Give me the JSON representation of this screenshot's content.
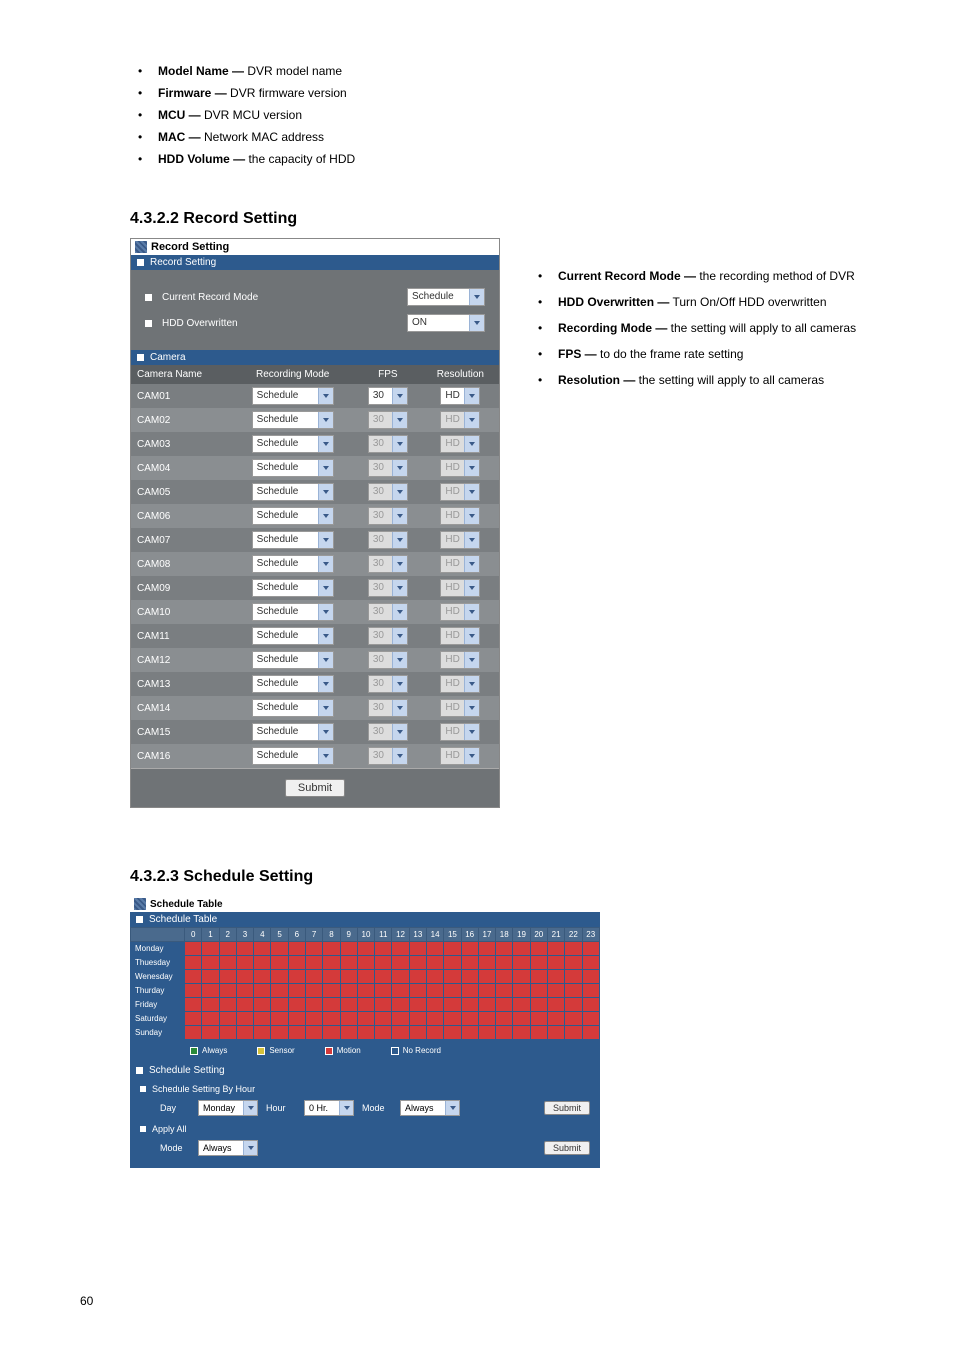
{
  "top_bullets": [
    {
      "term": "Model Name —",
      "desc": " DVR model name"
    },
    {
      "term": "Firmware —",
      "desc": " DVR firmware version"
    },
    {
      "term": "MCU —",
      "desc": " DVR MCU version"
    },
    {
      "term": "MAC —",
      "desc": " Network MAC address"
    },
    {
      "term": "HDD Volume —",
      "desc": " the capacity of HDD"
    }
  ],
  "section_heading": "4.3.2.2 Record Setting",
  "record_panel": {
    "title": "Record Setting",
    "sub1": "Record Setting",
    "row1_label": "Current Record Mode",
    "row1_value": "Schedule",
    "row2_label": "HDD Overwritten",
    "row2_value": "ON",
    "sub2": "Camera",
    "headers": [
      "Camera Name",
      "Recording Mode",
      "FPS",
      "Resolution"
    ],
    "cameras": [
      {
        "name": "CAM01",
        "mode": "Schedule",
        "fps": "30",
        "res": "HD",
        "fps_dis": false,
        "res_dis": false
      },
      {
        "name": "CAM02",
        "mode": "Schedule",
        "fps": "30",
        "res": "HD",
        "fps_dis": true,
        "res_dis": true
      },
      {
        "name": "CAM03",
        "mode": "Schedule",
        "fps": "30",
        "res": "HD",
        "fps_dis": true,
        "res_dis": true
      },
      {
        "name": "CAM04",
        "mode": "Schedule",
        "fps": "30",
        "res": "HD",
        "fps_dis": true,
        "res_dis": true
      },
      {
        "name": "CAM05",
        "mode": "Schedule",
        "fps": "30",
        "res": "HD",
        "fps_dis": true,
        "res_dis": true
      },
      {
        "name": "CAM06",
        "mode": "Schedule",
        "fps": "30",
        "res": "HD",
        "fps_dis": true,
        "res_dis": true
      },
      {
        "name": "CAM07",
        "mode": "Schedule",
        "fps": "30",
        "res": "HD",
        "fps_dis": true,
        "res_dis": true
      },
      {
        "name": "CAM08",
        "mode": "Schedule",
        "fps": "30",
        "res": "HD",
        "fps_dis": true,
        "res_dis": true
      },
      {
        "name": "CAM09",
        "mode": "Schedule",
        "fps": "30",
        "res": "HD",
        "fps_dis": true,
        "res_dis": true
      },
      {
        "name": "CAM10",
        "mode": "Schedule",
        "fps": "30",
        "res": "HD",
        "fps_dis": true,
        "res_dis": true
      },
      {
        "name": "CAM11",
        "mode": "Schedule",
        "fps": "30",
        "res": "HD",
        "fps_dis": true,
        "res_dis": true
      },
      {
        "name": "CAM12",
        "mode": "Schedule",
        "fps": "30",
        "res": "HD",
        "fps_dis": true,
        "res_dis": true
      },
      {
        "name": "CAM13",
        "mode": "Schedule",
        "fps": "30",
        "res": "HD",
        "fps_dis": true,
        "res_dis": true
      },
      {
        "name": "CAM14",
        "mode": "Schedule",
        "fps": "30",
        "res": "HD",
        "fps_dis": true,
        "res_dis": true
      },
      {
        "name": "CAM15",
        "mode": "Schedule",
        "fps": "30",
        "res": "HD",
        "fps_dis": true,
        "res_dis": true
      },
      {
        "name": "CAM16",
        "mode": "Schedule",
        "fps": "30",
        "res": "HD",
        "fps_dis": true,
        "res_dis": true
      }
    ],
    "submit": "Submit"
  },
  "right_bullets": [
    {
      "term": "Current Record Mode —",
      "desc": " the recording method of DVR"
    },
    {
      "term": "HDD Overwritten —",
      "desc": " Turn On/Off HDD overwritten"
    },
    {
      "term": "Recording Mode —",
      "desc": " the setting will apply to all cameras"
    },
    {
      "term": "FPS —",
      "desc": " to do the frame rate setting"
    },
    {
      "term": "Resolution —",
      "desc": " the setting will apply to all cameras"
    }
  ],
  "section_heading2": "4.3.2.3 Schedule Setting",
  "sched_panel": {
    "title": "Schedule Table",
    "sub1": "Schedule Table",
    "hours": [
      "0",
      "1",
      "2",
      "3",
      "4",
      "5",
      "6",
      "7",
      "8",
      "9",
      "10",
      "11",
      "12",
      "13",
      "14",
      "15",
      "16",
      "17",
      "18",
      "19",
      "20",
      "21",
      "22",
      "23"
    ],
    "days": [
      "Monday",
      "Thuesday",
      "Wenesday",
      "Thurday",
      "Friday",
      "Saturday",
      "Sunday"
    ],
    "legend": [
      {
        "label": "Always",
        "color": "green"
      },
      {
        "label": "Sensor",
        "color": "yellow"
      },
      {
        "label": "Motion",
        "color": "red"
      },
      {
        "label": "No Record",
        "color": "blue"
      }
    ],
    "sub2": "Schedule Setting",
    "byhour_label": "Schedule Setting By Hour",
    "day_label": "Day",
    "day_value": "Monday",
    "hour_label": "Hour",
    "hour_value": "0 Hr.",
    "mode_label": "Mode",
    "mode_value": "Always",
    "applyall_label": "Apply All",
    "applyall_mode_label": "Mode",
    "applyall_mode_value": "Always",
    "submit": "Submit"
  },
  "page_number": "60"
}
